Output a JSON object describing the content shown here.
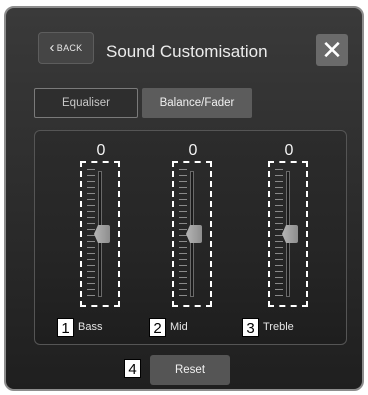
{
  "header": {
    "back_label": "BACK",
    "back_icon": "chevron-left-icon",
    "title": "Sound Customisation",
    "close_icon": "close-icon",
    "close_glyph": "✕"
  },
  "tabs": [
    {
      "label": "Equaliser"
    },
    {
      "label": "Balance/Fader"
    }
  ],
  "bands": [
    {
      "name": "Bass",
      "value": "0",
      "level": 0,
      "callout": "1"
    },
    {
      "name": "Mid",
      "value": "0",
      "level": 0,
      "callout": "2"
    },
    {
      "name": "Treble",
      "value": "0",
      "level": 0,
      "callout": "3"
    }
  ],
  "reset": {
    "label": "Reset",
    "callout": "4"
  },
  "colors": {
    "panel_bg": "#2b2b2b",
    "panel_border": "#8d8d8d",
    "button_bg": "#555555",
    "callout_bg": "#ffffff"
  }
}
